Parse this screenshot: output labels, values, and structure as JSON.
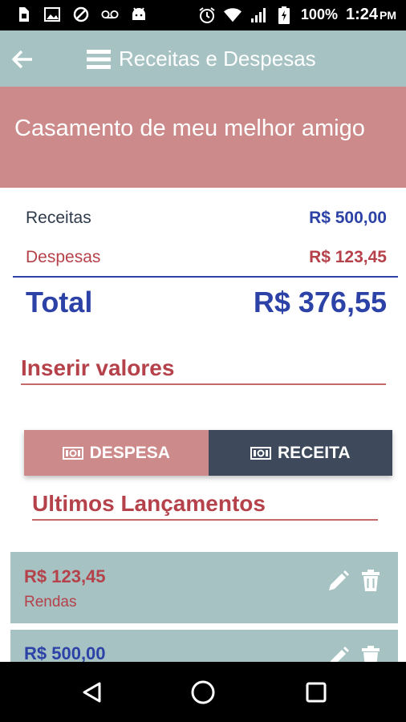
{
  "status_bar": {
    "icons_left": [
      "sim-card-icon",
      "image-icon",
      "shield-icon",
      "voicemail-icon",
      "android-icon"
    ],
    "icons_right": [
      "alarm-icon",
      "wifi-icon",
      "signal-icon",
      "battery-icon"
    ],
    "battery": "100%",
    "time": "1:24",
    "ampm": "PM"
  },
  "app_bar": {
    "title": "Receitas e Despesas",
    "icons": [
      "back-arrow-icon",
      "menu-icon"
    ]
  },
  "banner": {
    "title": "Casamento de meu melhor amigo"
  },
  "summary": {
    "receitas_label": "Receitas",
    "receitas_value": "R$ 500,00",
    "despesas_label": "Despesas",
    "despesas_value": "R$ 123,45",
    "total_label": "Total",
    "total_value": "R$ 376,55"
  },
  "insert_section": {
    "title": "Inserir valores",
    "despesa_button": "DESPESA",
    "receita_button": "RECEITA",
    "button_icon": "money-icon"
  },
  "recent_section": {
    "title": "Ultimos Lançamentos",
    "items": [
      {
        "amount": "R$ 123,45",
        "category": "Rendas",
        "type": "despesa"
      },
      {
        "amount": "R$ 500,00",
        "category": "",
        "type": "receita"
      }
    ]
  },
  "nav_bar": {
    "icons": [
      "back-triangle-icon",
      "home-circle-icon",
      "recents-square-icon"
    ]
  },
  "colors": {
    "teal": "#a6c2c2",
    "rose": "#cd8a8a",
    "navy": "#3e4a5c",
    "blue": "#2c42a7",
    "red": "#b5414a"
  }
}
